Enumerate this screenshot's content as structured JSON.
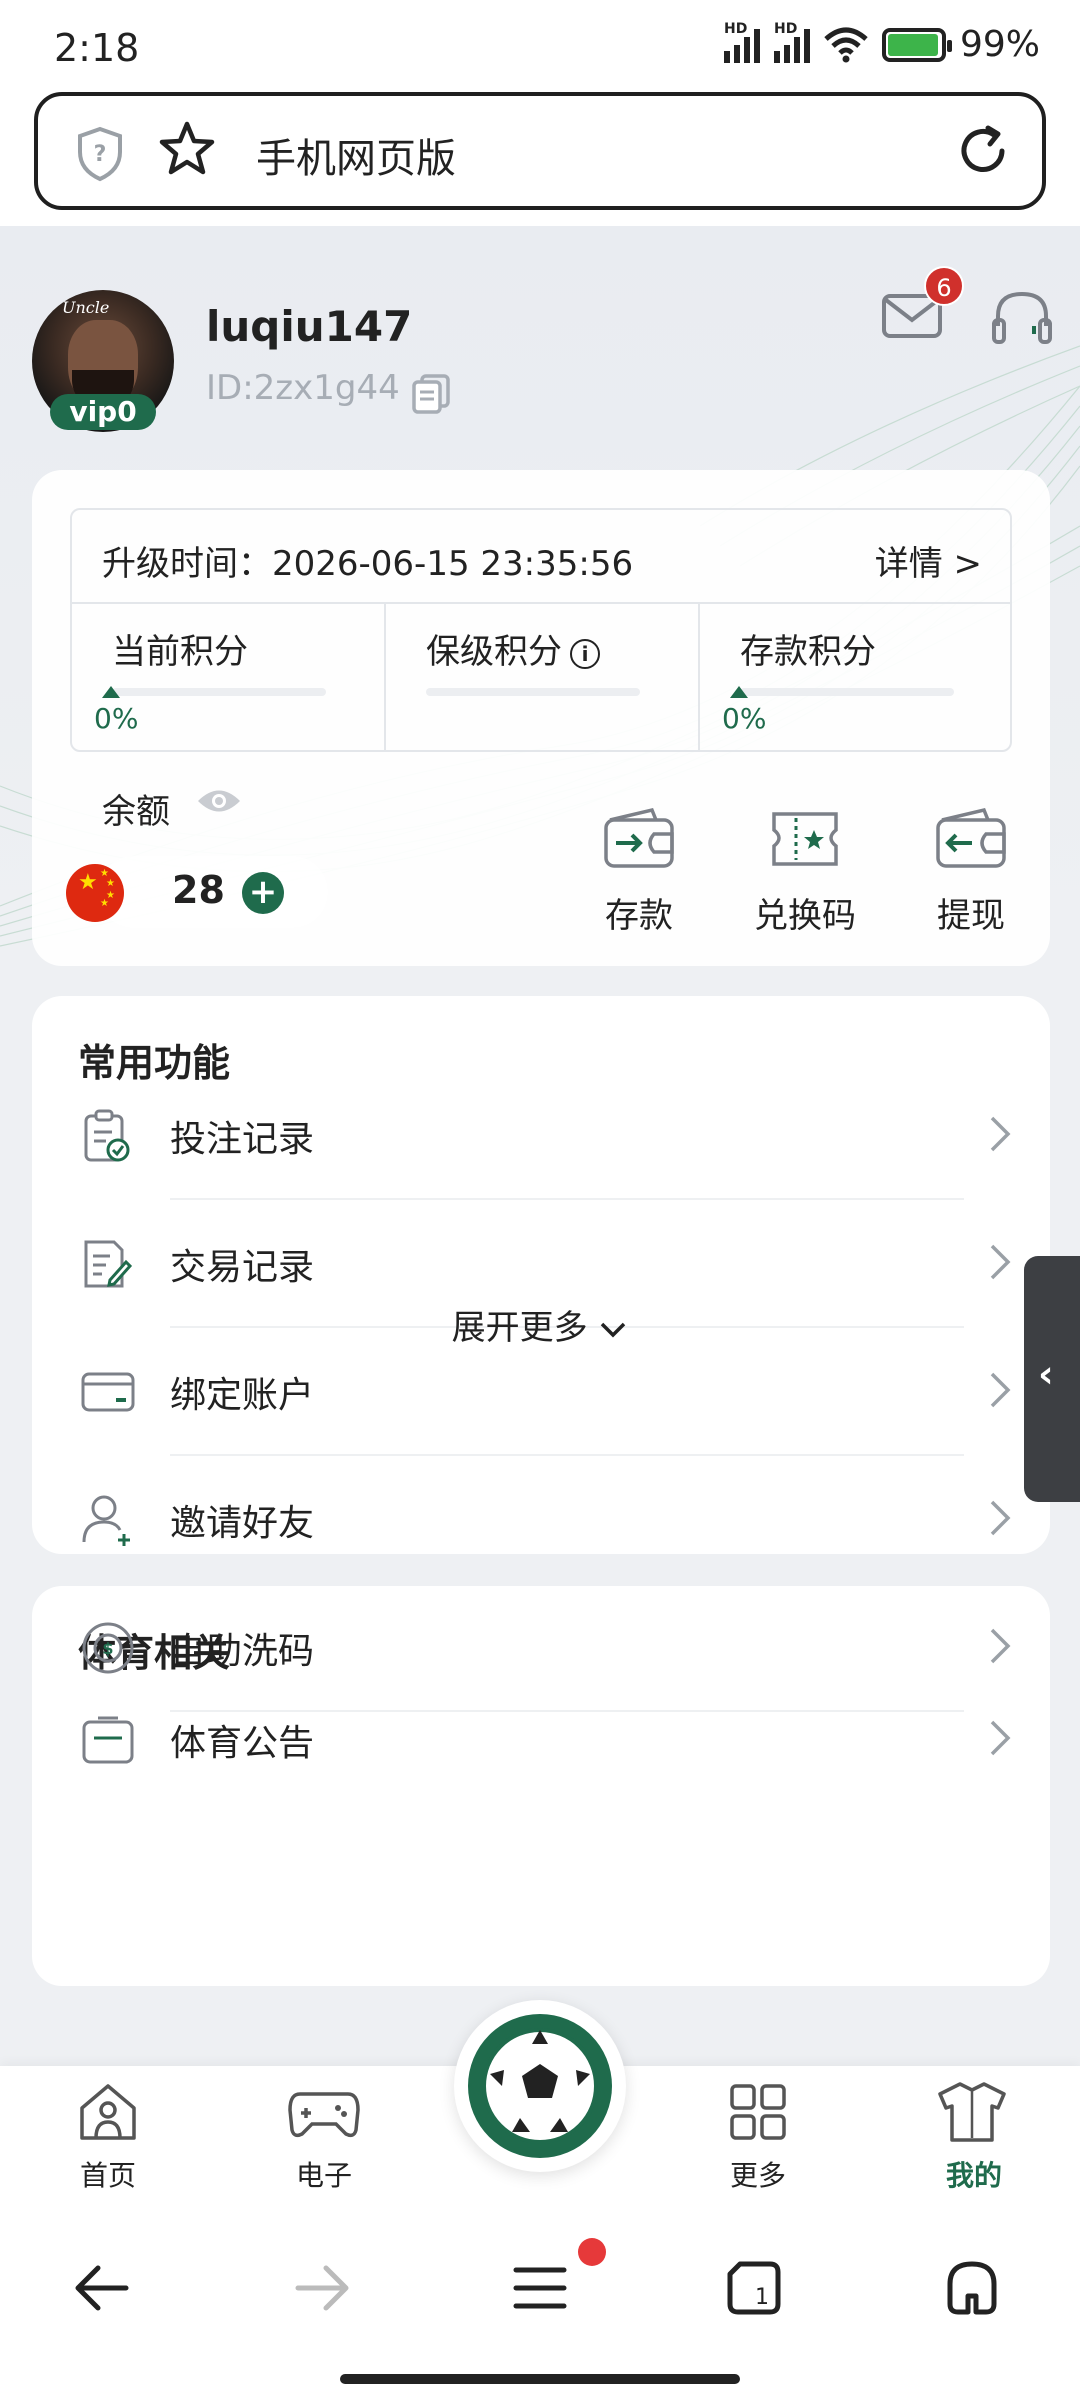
{
  "status_bar": {
    "time": "2:18",
    "signal1_tag": "HD",
    "signal2_tag": "HD",
    "battery_text": "99%"
  },
  "browser": {
    "url_text": "手机网页版"
  },
  "profile": {
    "username": "luqiu147",
    "user_id": "ID:2zx1g44",
    "vip_label": "vip0",
    "avatar_text": "Uncle",
    "mail_count": "6"
  },
  "account": {
    "upgrade_label": "升级时间：",
    "upgrade_time": "2026-06-15 23:35:56",
    "details_label": "详情 >",
    "points": [
      {
        "label": "当前积分",
        "percent": "0%"
      },
      {
        "label": "保级积分",
        "percent": ""
      },
      {
        "label": "存款积分",
        "percent": "0%"
      }
    ],
    "balance_label": "余额",
    "balance_value": "28",
    "actions": {
      "deposit": "存款",
      "redeem": "兑换码",
      "withdraw": "提现"
    }
  },
  "common_functions": {
    "title": "常用功能",
    "items": [
      {
        "label": "投注记录",
        "icon": "clipboard-check-icon"
      },
      {
        "label": "交易记录",
        "icon": "edit-document-icon"
      },
      {
        "label": "绑定账户",
        "icon": "card-icon"
      },
      {
        "label": "邀请好友",
        "icon": "add-user-icon"
      },
      {
        "label": "自助洗码",
        "icon": "chip-icon"
      }
    ],
    "expand_label": "展开更多"
  },
  "sports": {
    "title": "体育相关",
    "items": [
      {
        "label": "体育公告"
      }
    ]
  },
  "app_nav": {
    "home": "首页",
    "games": "电子",
    "more": "更多",
    "mine": "我的"
  },
  "colors": {
    "brand": "#1f6b4c",
    "badge": "#d0302c",
    "menu_dot": "#e6393a"
  }
}
